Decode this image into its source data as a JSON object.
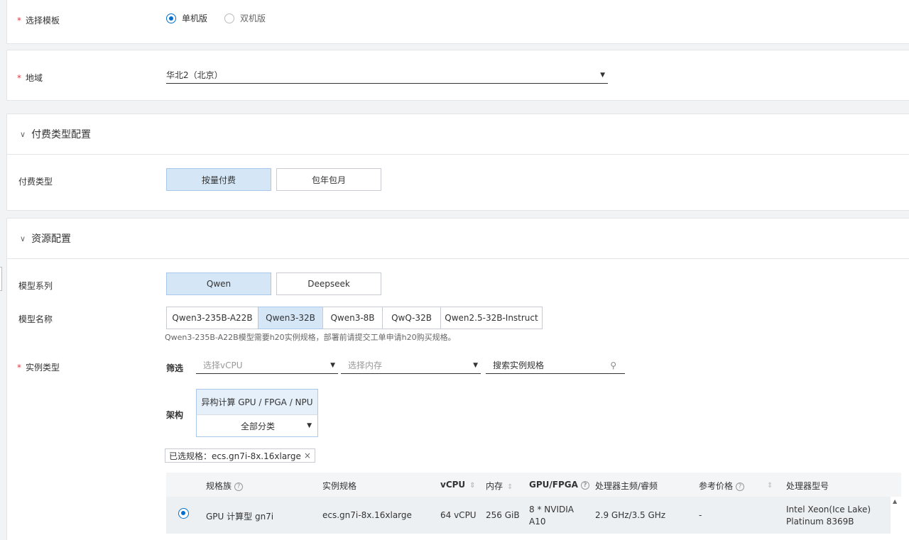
{
  "template": {
    "label": "选择模板",
    "options": [
      "单机版",
      "双机版"
    ],
    "selected": 0
  },
  "region": {
    "label": "地域",
    "value": "华北2（北京）"
  },
  "billing_section": {
    "title": "付费类型配置",
    "label": "付费类型",
    "options": [
      "按量付费",
      "包年包月"
    ],
    "selected": 0
  },
  "resource_section": {
    "title": "资源配置",
    "model_series": {
      "label": "模型系列",
      "options": [
        "Qwen",
        "Deepseek"
      ],
      "selected": 0
    },
    "model_name": {
      "label": "模型名称",
      "options": [
        "Qwen3-235B-A22B",
        "Qwen3-32B",
        "Qwen3-8B",
        "QwQ-32B",
        "Qwen2.5-32B-Instruct"
      ],
      "selected": 1,
      "hint": "Qwen3-235B-A22B模型需要h20实例规格，部署前请提交工单申请h20购买规格。"
    },
    "instance_type": {
      "label": "实例类型",
      "filter_label": "筛选",
      "vcpu_placeholder": "选择vCPU",
      "memory_placeholder": "选择内存",
      "search_placeholder": "搜索实例规格",
      "arch_label": "架构",
      "arch_tab": "异构计算 GPU / FPGA / NPU",
      "arch_category": "全部分类",
      "selected_tag": "已选规格：ecs.gn7i-8x.16xlarge",
      "table": {
        "headers": [
          "规格族",
          "实例规格",
          "vCPU",
          "内存",
          "GPU/FPGA",
          "处理器主频/睿频",
          "参考价格",
          "处理器型号"
        ],
        "rows": [
          {
            "family": "GPU 计算型 gn7i",
            "spec": "ecs.gn7i-8x.16xlarge",
            "vcpu": "64 vCPU",
            "memory": "256 GiB",
            "gpu_line1": "8 * NVIDIA",
            "gpu_line2": "A10",
            "freq": "2.9 GHz/3.5 GHz",
            "price": "-",
            "cpu_line1": "Intel Xeon(Ice Lake)",
            "cpu_line2": "Platinum 8369B"
          }
        ]
      }
    }
  },
  "colors": {
    "accent": "#0070cc",
    "required": "#e4393c",
    "selected_bg": "#d5e6f7"
  }
}
